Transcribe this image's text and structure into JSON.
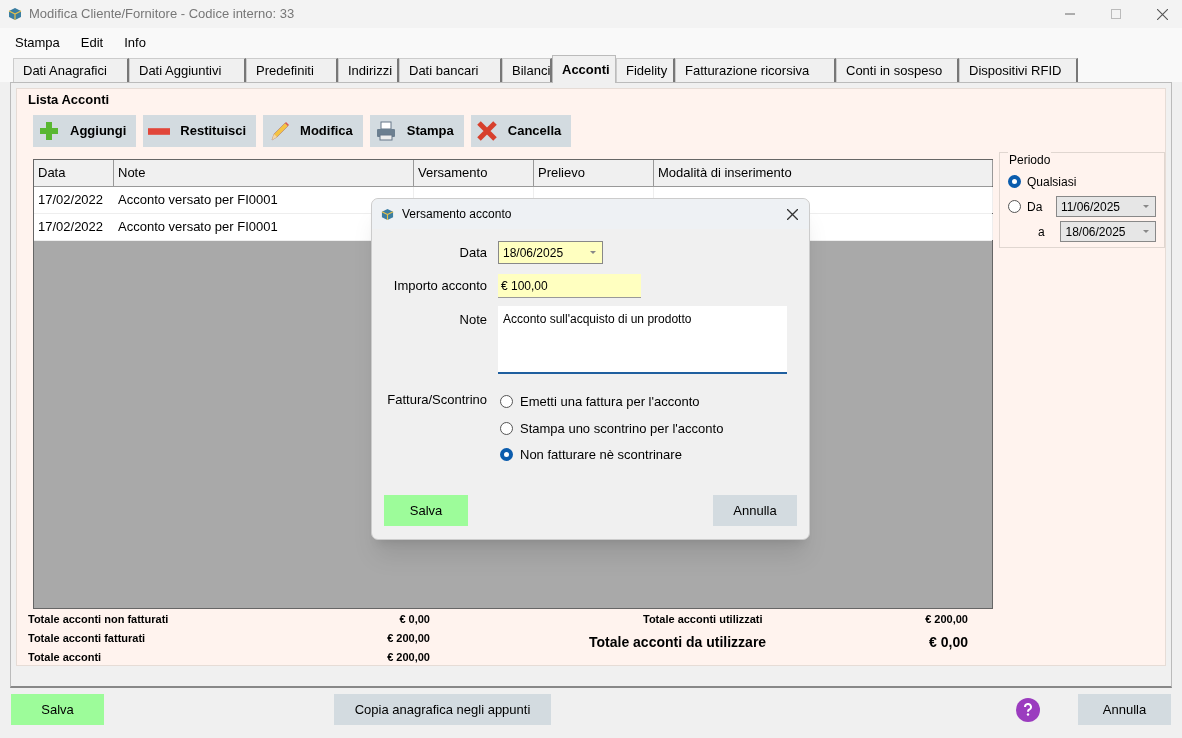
{
  "window": {
    "title": "Modifica Cliente/Fornitore - Codice interno: 33"
  },
  "menu": [
    "Stampa",
    "Edit",
    "Info"
  ],
  "tabs": [
    {
      "label": "Dati Anagrafici",
      "selected": false
    },
    {
      "label": "Dati Aggiuntivi",
      "selected": false
    },
    {
      "label": "Predefiniti",
      "selected": false
    },
    {
      "label": "Indirizzi",
      "selected": false
    },
    {
      "label": "Dati bancari",
      "selected": false
    },
    {
      "label": "Bilanci",
      "selected": false
    },
    {
      "label": "Acconti",
      "selected": true
    },
    {
      "label": "Fidelity",
      "selected": false
    },
    {
      "label": "Fatturazione ricorsiva",
      "selected": false
    },
    {
      "label": "Conti in sospeso",
      "selected": false
    },
    {
      "label": "Dispositivi RFID",
      "selected": false
    }
  ],
  "group_title": "Lista Acconti",
  "toolbar": [
    {
      "label": "Aggiungi",
      "kind": "add"
    },
    {
      "label": "Restituisci",
      "kind": "remove"
    },
    {
      "label": "Modifica",
      "kind": "edit"
    },
    {
      "label": "Stampa",
      "kind": "print"
    },
    {
      "label": "Cancella",
      "kind": "delete"
    }
  ],
  "table": {
    "columns": [
      "Data",
      "Note",
      "Versamento",
      "Prelievo",
      "Modalità di inserimento"
    ],
    "rows": [
      [
        "17/02/2022",
        "Acconto versato per FI0001",
        "",
        "",
        ""
      ],
      [
        "17/02/2022",
        "Acconto versato per FI0001",
        "",
        "",
        ""
      ]
    ]
  },
  "period": {
    "title": "Periodo",
    "options": [
      {
        "label": "Qualsiasi",
        "selected": true
      },
      {
        "label": "Da",
        "selected": false
      }
    ],
    "from": "11/06/2025",
    "to_label": "a",
    "to": "18/06/2025"
  },
  "totals_left": [
    {
      "label": "Totale acconti non fatturati",
      "value": "€ 0,00"
    },
    {
      "label": "Totale acconti fatturati",
      "value": "€ 200,00"
    },
    {
      "label": "Totale acconti",
      "value": "€ 200,00"
    }
  ],
  "totals_right": [
    {
      "label": "Totale acconti utilizzati",
      "value": "€ 200,00",
      "big": false
    },
    {
      "label": "Totale acconti da utilizzare",
      "value": "€ 0,00",
      "big": true
    }
  ],
  "footer": {
    "save": "Salva",
    "copy": "Copia anagrafica negli appunti",
    "cancel": "Annulla"
  },
  "dialog": {
    "title": "Versamento acconto",
    "date_label": "Data",
    "date": "18/06/2025",
    "amount_label": "Importo acconto",
    "amount": "€ 100,00",
    "note_label": "Note",
    "note": "Acconto sull'acquisto di un prodotto",
    "invoice_label": "Fattura/Scontrino",
    "options": [
      {
        "label": "Emetti una fattura per l'acconto",
        "selected": false
      },
      {
        "label": "Stampa uno scontrino per l'acconto",
        "selected": false
      },
      {
        "label": "Non fatturare nè scontrinare",
        "selected": true
      }
    ],
    "save": "Salva",
    "cancel": "Annulla"
  }
}
